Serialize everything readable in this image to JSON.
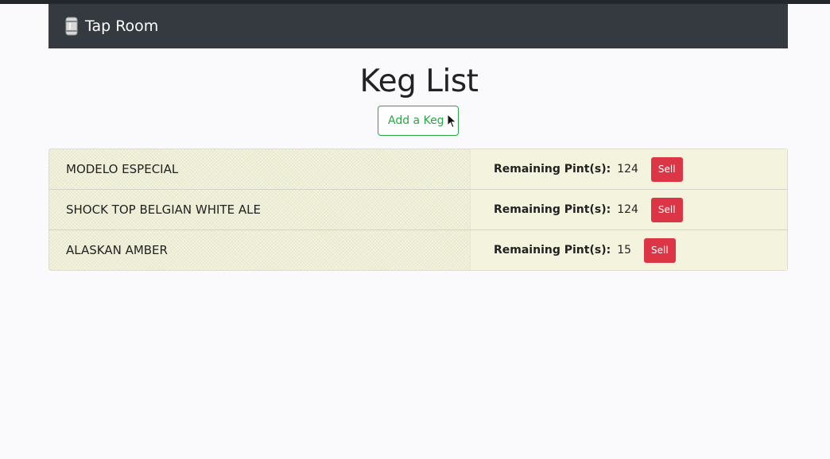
{
  "navbar": {
    "brand_label": "Tap Room",
    "brand_icon": "keg-icon"
  },
  "main": {
    "title": "Keg List",
    "add_button_label": "Add a Keg"
  },
  "kegs": {
    "remaining_label": "Remaining Pint(s):",
    "sell_label": "Sell",
    "items": [
      {
        "name": "MODELO ESPECIAL",
        "remaining": "124"
      },
      {
        "name": "SHOCK TOP BELGIAN WHITE ALE",
        "remaining": "124"
      },
      {
        "name": "ALASKAN AMBER",
        "remaining": "15"
      }
    ]
  },
  "colors": {
    "navbar_bg": "#343a40",
    "add_button": "#28a745",
    "sell_button": "#dc3545",
    "list_bg": "#efefd6"
  }
}
